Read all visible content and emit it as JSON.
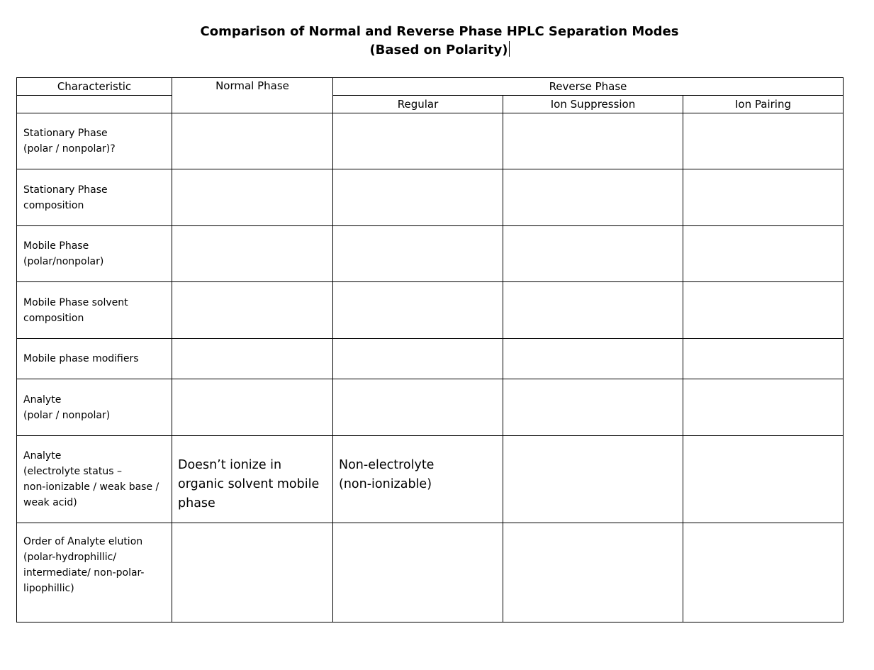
{
  "document": {
    "title_line1": "Comparison of Normal and Reverse Phase HPLC Separation Modes",
    "title_line2": "(Based on Polarity)"
  },
  "table": {
    "headers": {
      "characteristic": "Characteristic",
      "normal_phase": "Normal Phase",
      "reverse_phase": "Reverse Phase",
      "sub_regular": "Regular",
      "sub_ion_suppression": "Ion Suppression",
      "sub_ion_pairing": "Ion Pairing"
    },
    "rows": [
      {
        "label_lines": [
          "Stationary Phase",
          "(polar / nonpolar)?"
        ],
        "normal": "",
        "regular": "",
        "ion_suppression": "",
        "ion_pairing": ""
      },
      {
        "label_lines": [
          "Stationary Phase",
          "composition"
        ],
        "normal": "",
        "regular": "",
        "ion_suppression": "",
        "ion_pairing": ""
      },
      {
        "label_lines": [
          "Mobile Phase",
          "(polar/nonpolar)"
        ],
        "normal": "",
        "regular": "",
        "ion_suppression": "",
        "ion_pairing": ""
      },
      {
        "label_lines": [
          "Mobile Phase solvent",
          "composition"
        ],
        "normal": "",
        "regular": "",
        "ion_suppression": "",
        "ion_pairing": ""
      },
      {
        "label_lines": [
          "Mobile phase modifiers"
        ],
        "normal": "",
        "regular": "",
        "ion_suppression": "",
        "ion_pairing": ""
      },
      {
        "label_lines": [
          "Analyte",
          "(polar / nonpolar)"
        ],
        "normal": "",
        "regular": "",
        "ion_suppression": "",
        "ion_pairing": ""
      },
      {
        "label_lines": [
          "Analyte",
          "(electrolyte status –",
          "non-ionizable / weak base /",
          "weak acid)"
        ],
        "normal_lines": [
          "Doesn’t ionize in",
          "organic solvent mobile",
          "phase"
        ],
        "regular_lines": [
          "Non-electrolyte",
          "(non-ionizable)"
        ],
        "ion_suppression": "",
        "ion_pairing": ""
      },
      {
        "label_lines": [
          "Order of Analyte elution",
          "(polar-hydrophillic/",
          "intermediate/ non-polar-",
          "lipophillic)",
          ""
        ],
        "normal": "",
        "regular": "",
        "ion_suppression": "",
        "ion_pairing": ""
      }
    ]
  }
}
